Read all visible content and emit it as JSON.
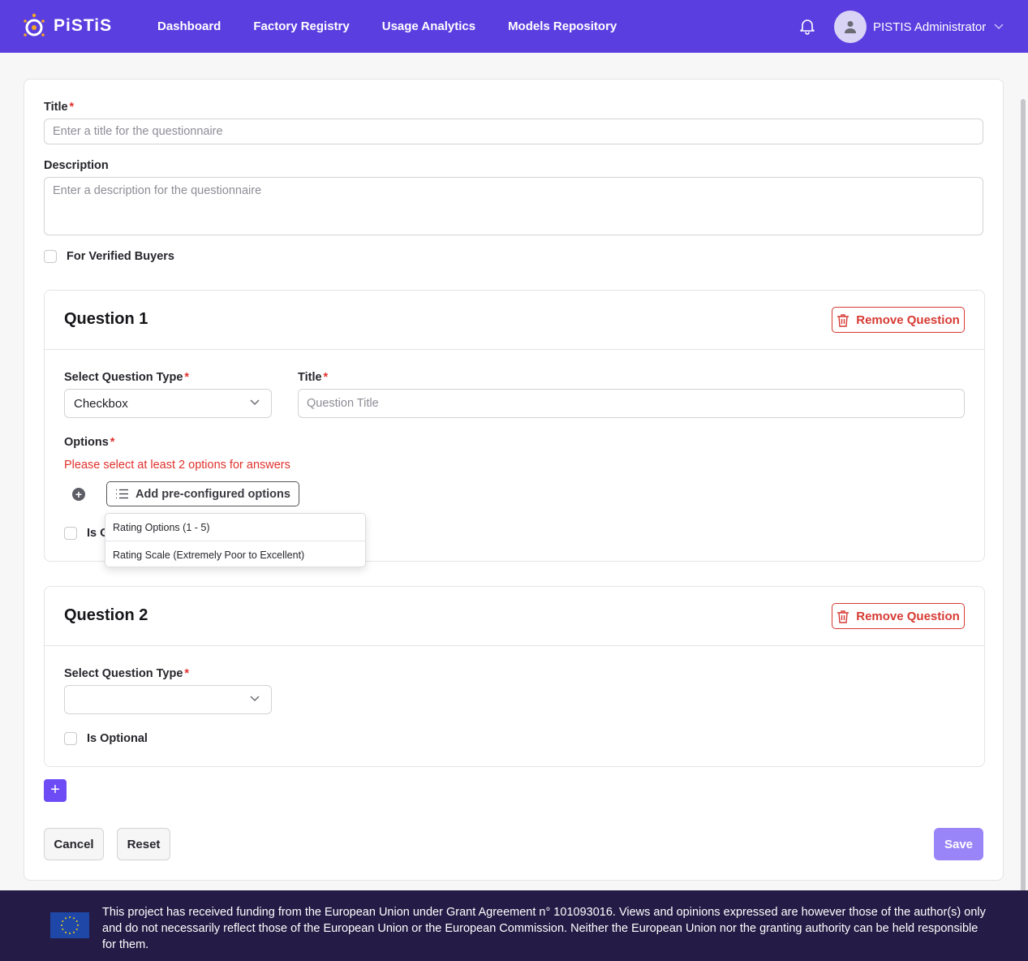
{
  "header": {
    "brand": "PiSTiS",
    "nav": [
      "Dashboard",
      "Factory Registry",
      "Usage Analytics",
      "Models Repository"
    ],
    "user_name": "PISTIS Administrator",
    "bg_color": "#5b3ee0"
  },
  "form": {
    "title_label": "Title",
    "title_placeholder": "Enter a title for the questionnaire",
    "description_label": "Description",
    "description_placeholder": "Enter a description for the questionnaire",
    "verified_label": "For Verified Buyers",
    "required_mark": "*"
  },
  "questions": [
    {
      "heading": "Question 1",
      "remove_label": "Remove Question",
      "type_label": "Select Question Type",
      "type_value": "Checkbox",
      "title_label": "Title",
      "title_placeholder": "Question Title",
      "options_label": "Options",
      "error": "Please select at least 2 options for answers",
      "preconf_label": "Add pre-configured options",
      "optional_label_partial": "Is O",
      "dropdown": [
        "Rating Options (1 - 5)",
        "Rating Scale (Extremely Poor to Excellent)"
      ]
    },
    {
      "heading": "Question 2",
      "remove_label": "Remove Question",
      "type_label": "Select Question Type",
      "type_value": "",
      "optional_label": "Is Optional"
    }
  ],
  "actions": {
    "add_question": "+",
    "cancel": "Cancel",
    "reset": "Reset",
    "save": "Save"
  },
  "footer": {
    "text": "This project has received funding from the European Union under Grant Agreement n° 101093016. Views and opinions expressed are however those of the author(s) only and do not necessarily reflect those of the European Union or the European Commission. Neither the European Union nor the granting authority can be held responsible for them."
  }
}
